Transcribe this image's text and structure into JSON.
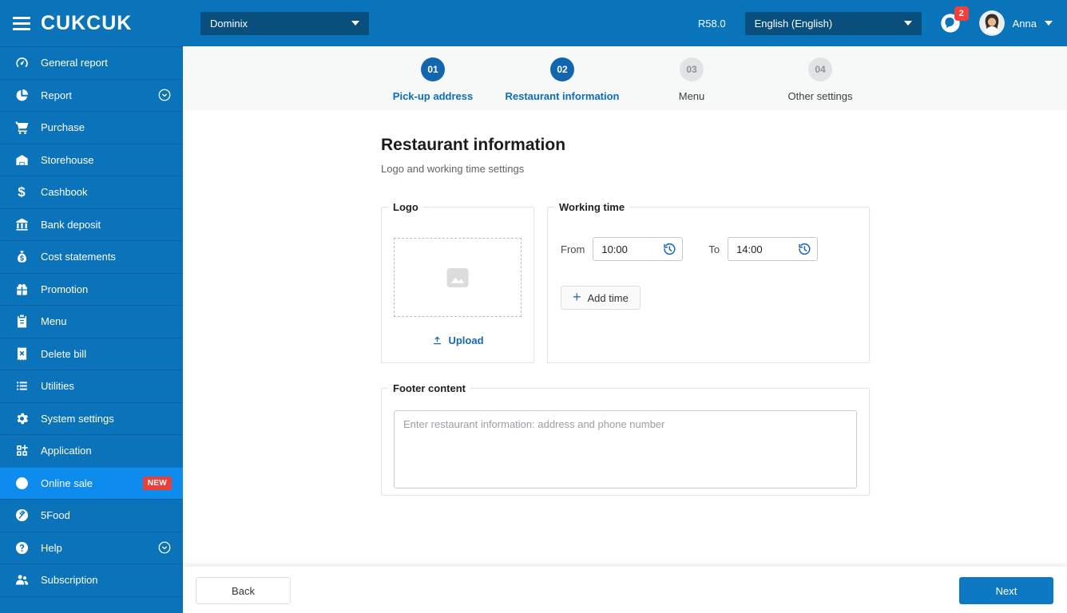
{
  "app": {
    "logo": "CUKCUK",
    "version": "R58.0"
  },
  "topbar": {
    "branch_selector": "Dominix",
    "language_selector": "English (English)",
    "notification_count": "2",
    "user_name": "Anna"
  },
  "sidebar": {
    "items": [
      {
        "label": "General report",
        "icon": "gauge-icon"
      },
      {
        "label": "Report",
        "icon": "pie-chart-icon",
        "expandable": true
      },
      {
        "label": "Purchase",
        "icon": "cart-icon"
      },
      {
        "label": "Storehouse",
        "icon": "warehouse-icon"
      },
      {
        "label": "Cashbook",
        "icon": "dollar-icon"
      },
      {
        "label": "Bank deposit",
        "icon": "bank-icon"
      },
      {
        "label": "Cost statements",
        "icon": "money-bag-icon"
      },
      {
        "label": "Promotion",
        "icon": "gift-icon"
      },
      {
        "label": "Menu",
        "icon": "clipboard-icon"
      },
      {
        "label": "Delete bill",
        "icon": "receipt-delete-icon"
      },
      {
        "label": "Utilities",
        "icon": "list-icon"
      },
      {
        "label": "System settings",
        "icon": "gear-icon"
      },
      {
        "label": "Application",
        "icon": "grid-plus-icon"
      },
      {
        "label": "Online sale",
        "icon": "globe-icon",
        "active": true,
        "badge": "NEW"
      },
      {
        "label": "5Food",
        "icon": "5food-icon"
      },
      {
        "label": "Help",
        "icon": "question-icon",
        "expandable": true
      },
      {
        "label": "Subscription",
        "icon": "people-icon"
      }
    ]
  },
  "stepper": {
    "steps": [
      {
        "number": "01",
        "label": "Pick-up address",
        "state": "done"
      },
      {
        "number": "02",
        "label": "Restaurant information",
        "state": "active"
      },
      {
        "number": "03",
        "label": "Menu",
        "state": "upcoming"
      },
      {
        "number": "04",
        "label": "Other settings",
        "state": "upcoming"
      }
    ]
  },
  "main": {
    "title": "Restaurant information",
    "subtitle": "Logo and working time settings",
    "logo_section": {
      "legend": "Logo",
      "upload_label": "Upload"
    },
    "working_time": {
      "legend": "Working time",
      "from_label": "From",
      "from_value": "10:00",
      "to_label": "To",
      "to_value": "14:00",
      "add_time_label": "Add time"
    },
    "footer_section": {
      "legend": "Footer content",
      "placeholder": "Enter restaurant information: address and phone number"
    }
  },
  "actions": {
    "back_label": "Back",
    "next_label": "Next"
  },
  "colors": {
    "sidebar_bg": "#0b73b9",
    "active_item_bg": "#0d8ced",
    "dropdown_bg": "#094f7d",
    "accent_blue": "#0d6db6",
    "badge_red": "#e8413b",
    "next_button": "#0d78c3"
  }
}
